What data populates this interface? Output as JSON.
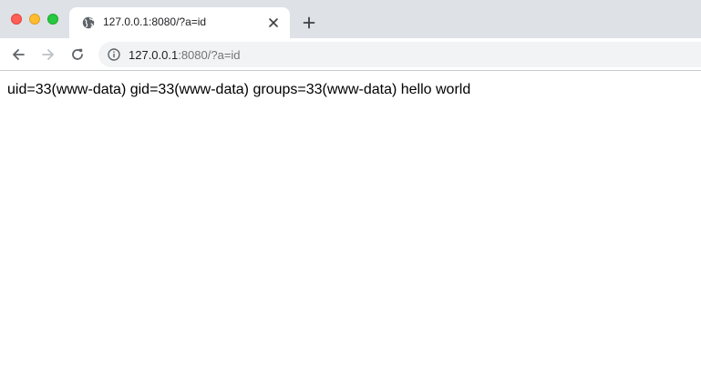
{
  "window": {
    "controls": [
      "close",
      "minimize",
      "zoom"
    ]
  },
  "tab": {
    "title": "127.0.0.1:8080/?a=id",
    "favicon": "globe-icon",
    "close_icon": "close-icon"
  },
  "new_tab_icon": "plus-icon",
  "toolbar": {
    "back_icon": "arrow-left-icon",
    "forward_icon": "arrow-right-icon",
    "reload_icon": "reload-icon",
    "info_icon": "info-icon",
    "url_host": "127.0.0.1",
    "url_rest": ":8080/?a=id"
  },
  "page": {
    "output": "uid=33(www-data) gid=33(www-data) groups=33(www-data) hello world"
  },
  "colors": {
    "tabstrip_bg": "#dee1e6",
    "omnibox_bg": "#f1f3f4",
    "close_red": "#ff5f57",
    "minimize_yellow": "#febc2e",
    "zoom_green": "#28c840"
  }
}
